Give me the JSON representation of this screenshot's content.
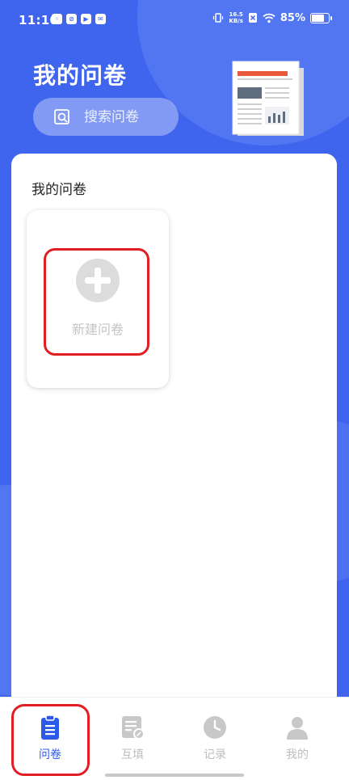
{
  "status": {
    "time": "11:10",
    "net_speed_value": "16.5",
    "net_speed_unit": "KB/s",
    "battery_percent": "85%",
    "battery_level": 0.85
  },
  "header": {
    "title": "我的问卷",
    "search_placeholder": "搜索问卷"
  },
  "main": {
    "section_title": "我的问卷",
    "new_survey_label": "新建问卷"
  },
  "nav": {
    "items": [
      {
        "label": "问卷",
        "icon": "clipboard-icon",
        "active": true
      },
      {
        "label": "互填",
        "icon": "edit-form-icon",
        "active": false
      },
      {
        "label": "记录",
        "icon": "clock-icon",
        "active": false
      },
      {
        "label": "我的",
        "icon": "user-icon",
        "active": false
      }
    ]
  },
  "colors": {
    "brand_blue": "#3f64ee",
    "active_tab": "#2b59e9",
    "inactive_tab": "#bdbdbd",
    "highlight_red": "#e21d24"
  }
}
